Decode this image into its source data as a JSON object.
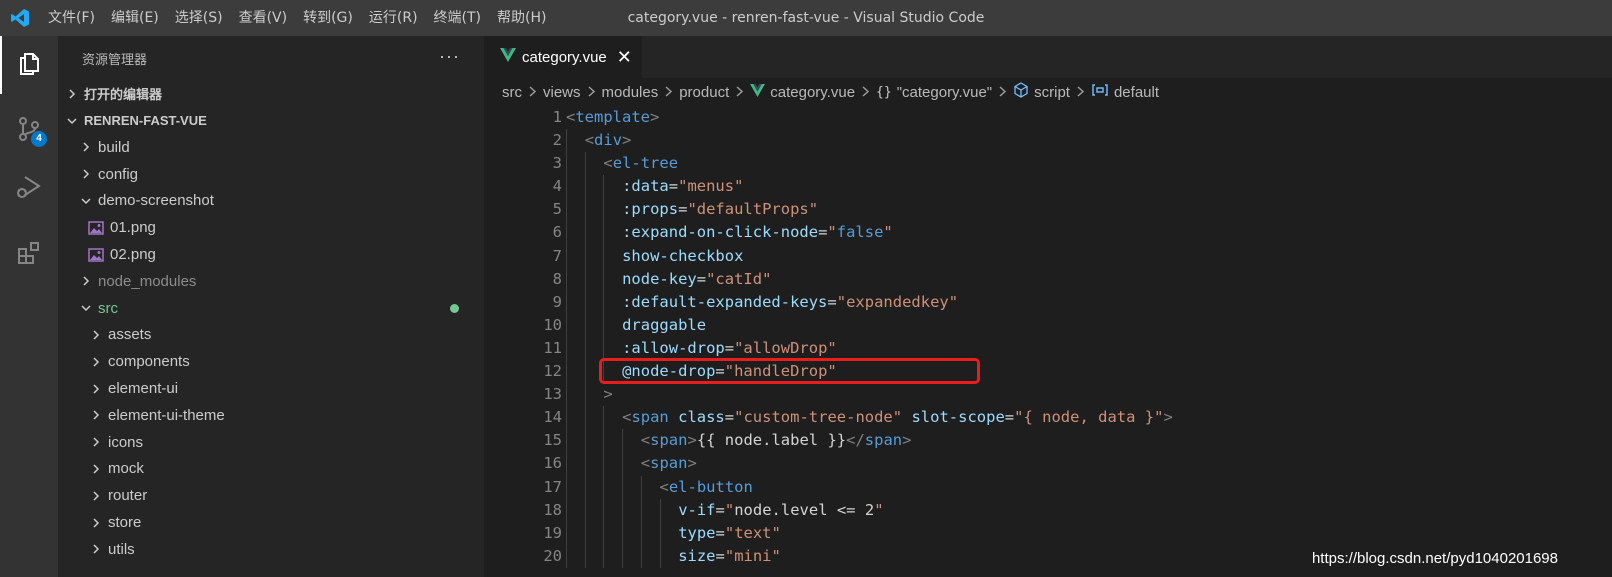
{
  "window": {
    "title": "category.vue - renren-fast-vue - Visual Studio Code",
    "menu": [
      "文件(F)",
      "编辑(E)",
      "选择(S)",
      "查看(V)",
      "转到(G)",
      "运行(R)",
      "终端(T)",
      "帮助(H)"
    ]
  },
  "activity_bar": {
    "items": [
      {
        "icon": "files-icon",
        "active": true
      },
      {
        "icon": "source-control-icon",
        "badge": "4"
      },
      {
        "icon": "run-debug-icon"
      },
      {
        "icon": "extensions-icon"
      }
    ],
    "colors": {
      "badge": "#007acc"
    }
  },
  "sidebar": {
    "header": "资源管理器",
    "more": "···",
    "open_editors": "打开的编辑器",
    "project": "RENREN-FAST-VUE",
    "tree": [
      {
        "label": "build",
        "type": "folder",
        "depth": 1,
        "expanded": false
      },
      {
        "label": "config",
        "type": "folder",
        "depth": 1,
        "expanded": false
      },
      {
        "label": "demo-screenshot",
        "type": "folder",
        "depth": 1,
        "expanded": true
      },
      {
        "label": "01.png",
        "type": "image",
        "depth": 2
      },
      {
        "label": "02.png",
        "type": "image",
        "depth": 2
      },
      {
        "label": "node_modules",
        "type": "folder",
        "depth": 1,
        "expanded": false,
        "dimmed": true
      },
      {
        "label": "src",
        "type": "folder",
        "depth": 1,
        "expanded": true,
        "modified": true
      },
      {
        "label": "assets",
        "type": "folder",
        "depth": 2,
        "expanded": false
      },
      {
        "label": "components",
        "type": "folder",
        "depth": 2,
        "expanded": false
      },
      {
        "label": "element-ui",
        "type": "folder",
        "depth": 2,
        "expanded": false
      },
      {
        "label": "element-ui-theme",
        "type": "folder",
        "depth": 2,
        "expanded": false
      },
      {
        "label": "icons",
        "type": "folder",
        "depth": 2,
        "expanded": false
      },
      {
        "label": "mock",
        "type": "folder",
        "depth": 2,
        "expanded": false
      },
      {
        "label": "router",
        "type": "folder",
        "depth": 2,
        "expanded": false
      },
      {
        "label": "store",
        "type": "folder",
        "depth": 2,
        "expanded": false
      },
      {
        "label": "utils",
        "type": "folder",
        "depth": 2,
        "expanded": false
      }
    ]
  },
  "editor": {
    "tab": {
      "label": "category.vue",
      "close": "✕",
      "icon": "vue-icon",
      "color": "#41b883"
    },
    "breadcrumb": [
      {
        "label": "src"
      },
      {
        "label": "views"
      },
      {
        "label": "modules"
      },
      {
        "label": "product"
      },
      {
        "label": "category.vue",
        "icon": "vue-icon"
      },
      {
        "label": "\"category.vue\"",
        "icon": "braces-icon",
        "glyph": "{}"
      },
      {
        "label": "script",
        "icon": "module-icon"
      },
      {
        "label": "default",
        "icon": "variable-icon"
      }
    ],
    "lines": [
      {
        "n": "1",
        "indent": 0,
        "tokens": [
          [
            "brk",
            "<"
          ],
          [
            "tag",
            "template"
          ],
          [
            "brk",
            ">"
          ]
        ]
      },
      {
        "n": "2",
        "indent": 1,
        "tokens": [
          [
            "brk",
            "<"
          ],
          [
            "tag",
            "div"
          ],
          [
            "brk",
            ">"
          ]
        ]
      },
      {
        "n": "3",
        "indent": 2,
        "tokens": [
          [
            "brk",
            "<"
          ],
          [
            "tag",
            "el-tree"
          ]
        ]
      },
      {
        "n": "4",
        "indent": 3,
        "tokens": [
          [
            "attr",
            ":data"
          ],
          [
            "txt",
            "="
          ],
          [
            "str",
            "\"menus\""
          ]
        ]
      },
      {
        "n": "5",
        "indent": 3,
        "tokens": [
          [
            "attr",
            ":props"
          ],
          [
            "txt",
            "="
          ],
          [
            "str",
            "\"defaultProps\""
          ]
        ]
      },
      {
        "n": "6",
        "indent": 3,
        "tokens": [
          [
            "attr",
            ":expand-on-click-node"
          ],
          [
            "txt",
            "="
          ],
          [
            "str",
            "\""
          ],
          [
            "kw",
            "false"
          ],
          [
            "str",
            "\""
          ]
        ]
      },
      {
        "n": "7",
        "indent": 3,
        "tokens": [
          [
            "attr",
            "show-checkbox"
          ]
        ]
      },
      {
        "n": "8",
        "indent": 3,
        "tokens": [
          [
            "attr",
            "node-key"
          ],
          [
            "txt",
            "="
          ],
          [
            "str",
            "\"catId\""
          ]
        ]
      },
      {
        "n": "9",
        "indent": 3,
        "tokens": [
          [
            "attr",
            ":default-expanded-keys"
          ],
          [
            "txt",
            "="
          ],
          [
            "str",
            "\"expandedkey\""
          ]
        ]
      },
      {
        "n": "10",
        "indent": 3,
        "tokens": [
          [
            "attr",
            "draggable"
          ]
        ]
      },
      {
        "n": "11",
        "indent": 3,
        "tokens": [
          [
            "attr",
            ":allow-drop"
          ],
          [
            "txt",
            "="
          ],
          [
            "str",
            "\"allowDrop\""
          ]
        ]
      },
      {
        "n": "12",
        "indent": 3,
        "tokens": [
          [
            "attr",
            "@node-drop"
          ],
          [
            "txt",
            "="
          ],
          [
            "str",
            "\"handleDrop\""
          ]
        ]
      },
      {
        "n": "13",
        "indent": 2,
        "tokens": [
          [
            "brk",
            ">"
          ]
        ]
      },
      {
        "n": "14",
        "indent": 3,
        "tokens": [
          [
            "brk",
            "<"
          ],
          [
            "tag",
            "span"
          ],
          [
            "txt",
            " "
          ],
          [
            "attr",
            "class"
          ],
          [
            "txt",
            "="
          ],
          [
            "str",
            "\"custom-tree-node\""
          ],
          [
            "txt",
            " "
          ],
          [
            "attr",
            "slot-scope"
          ],
          [
            "txt",
            "="
          ],
          [
            "str",
            "\"{ node, data }\""
          ],
          [
            "brk",
            ">"
          ]
        ]
      },
      {
        "n": "15",
        "indent": 4,
        "tokens": [
          [
            "brk",
            "<"
          ],
          [
            "tag",
            "span"
          ],
          [
            "brk",
            ">"
          ],
          [
            "txt",
            "{{ node.label }}"
          ],
          [
            "brk",
            "</"
          ],
          [
            "tag",
            "span"
          ],
          [
            "brk",
            ">"
          ]
        ]
      },
      {
        "n": "16",
        "indent": 4,
        "tokens": [
          [
            "brk",
            "<"
          ],
          [
            "tag",
            "span"
          ],
          [
            "brk",
            ">"
          ]
        ]
      },
      {
        "n": "17",
        "indent": 5,
        "tokens": [
          [
            "brk",
            "<"
          ],
          [
            "tag",
            "el-button"
          ]
        ]
      },
      {
        "n": "18",
        "indent": 6,
        "tokens": [
          [
            "attr",
            "v-if"
          ],
          [
            "txt",
            "="
          ],
          [
            "str",
            "\""
          ],
          [
            "txt",
            "node.level <= 2"
          ],
          [
            "str",
            "\""
          ]
        ]
      },
      {
        "n": "19",
        "indent": 6,
        "tokens": [
          [
            "attr",
            "type"
          ],
          [
            "txt",
            "="
          ],
          [
            "str",
            "\"text\""
          ]
        ]
      },
      {
        "n": "20",
        "indent": 6,
        "tokens": [
          [
            "attr",
            "size"
          ],
          [
            "txt",
            "="
          ],
          [
            "str",
            "\"mini\""
          ]
        ]
      }
    ],
    "highlighted_line": "12"
  },
  "watermark": "https://blog.csdn.net/pyd1040201698"
}
